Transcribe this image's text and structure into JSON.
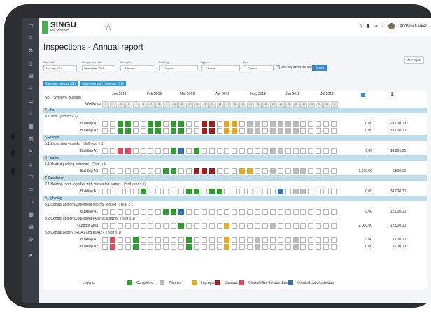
{
  "header": {
    "logo_name": "SINGU",
    "logo_sub": "FM Platform",
    "user_name": "Andrew Farker"
  },
  "page": {
    "title": "Inspections - Annual report",
    "export_label": "XLS export"
  },
  "filters": [
    {
      "label": "Start date",
      "value": "January 2018"
    },
    {
      "label": "Completion date",
      "value": "December 2018"
    },
    {
      "label": "Complex",
      "value": "-- Choose --"
    },
    {
      "label": "Building",
      "value": "-- Choose --"
    },
    {
      "label": "System",
      "value": "-- Choose --"
    },
    {
      "label": "Type",
      "value": "-- Choose --"
    }
  ],
  "filter_checkbox_label": "Just only weeks and daily",
  "search_label": "Search",
  "tags": [
    "Start date: January 2018",
    "Completion date: December 2018"
  ],
  "table": {
    "col_no": "No.",
    "col_system": "System / Building",
    "col_weeks": "Weeks no.",
    "months": [
      "Jan 2018",
      "Feb 2018",
      "Mar 2018",
      "Apr 2018",
      "May 2018",
      "Jun 2018",
      "Jul 2018"
    ],
    "weeks": [
      "1",
      "2",
      "3",
      "4",
      "5",
      "6",
      "7",
      "8",
      "9",
      "10",
      "11",
      "12",
      "13",
      "14",
      "15",
      "16",
      "17",
      "18",
      "19",
      "20",
      "21",
      "22",
      "23",
      "24",
      "25",
      "26",
      "27",
      "28",
      "29",
      "30",
      "31"
    ],
    "sum_label": "Σ"
  },
  "rows": [
    {
      "kind": "section",
      "text": "4 Lifts"
    },
    {
      "kind": "group",
      "no": "4.1",
      "name": "Lifts",
      "freq": "(Month x 1)"
    },
    {
      "kind": "building",
      "name": "Building A1",
      "cells": "..GG..GG.GG..RR.YY.PP.PPPP",
      "v1": "0.00",
      "v2": "28,000.00"
    },
    {
      "kind": "building",
      "name": "Building A2",
      "cells": "..GG..GG.GG..RR.YY.PP.PPPP",
      "v1": "0.00",
      "v2": "28,000.00"
    },
    {
      "kind": "section",
      "text": "5 Fittings"
    },
    {
      "kind": "group",
      "no": "5.1",
      "name": "Expansion vessels",
      "freq": "(Half year x 1)"
    },
    {
      "kind": "building",
      "name": "Building A1",
      "cells": "..LL.....GB.G.........PP.....",
      "v1": "0.00",
      "v2": "14,000.00"
    },
    {
      "kind": "section",
      "text": "6 Heating"
    },
    {
      "kind": "group",
      "no": "6.1",
      "name": "Heated parking entrance",
      "freq": "(Year x 1)"
    },
    {
      "kind": "building",
      "name": "Building A2",
      "cells": "........GG..RRR...YY..P..PP.",
      "v1": "1,500.00",
      "v2": "6,500.00"
    },
    {
      "kind": "section",
      "text": "7 Substation"
    },
    {
      "kind": "group",
      "no": "7.1",
      "name": "Heating room together with circulation pumps",
      "freq": "(Half year x 1)"
    },
    {
      "kind": "building",
      "name": "Building A1",
      "cells": ".....G.....GG.GG.......B.PP..",
      "v1": "0.00",
      "v2": "34,000.00"
    },
    {
      "kind": "section",
      "text": "8 Lightning"
    },
    {
      "kind": "group",
      "no": "8.1",
      "name": "Control and/or supplement internal lighting",
      "freq": "(Year x 1)"
    },
    {
      "kind": "building",
      "name": "Building A1",
      "cells": "........GGB.................",
      "v1": "0.00",
      "v2": "12,000.00"
    },
    {
      "kind": "group",
      "no": "8.2",
      "name": "Control and/or supplement external lighting",
      "freq": "(Year x 1)"
    },
    {
      "kind": "building",
      "name": "Outdoor area",
      "cells": "..........G.....Y.....P.....",
      "v1": "2,000.00",
      "v2": "12,000.00"
    },
    {
      "kind": "group",
      "no": "8.3",
      "name": "Central battery (RDA1 and RDA2)",
      "freq": "(Year x 1)"
    },
    {
      "kind": "building",
      "name": "Building A1",
      "cells": ".L..G......G....Y...P....P...",
      "v1": "0.00",
      "v2": "5,000.00"
    },
    {
      "kind": "building",
      "name": "Building A2",
      "cells": ".L..G......G....Y...P....P...",
      "v1": "0.00",
      "v2": "5,000.00"
    }
  ],
  "legend": {
    "title": "Legend:",
    "items": [
      {
        "label": "Completed",
        "color": "#2ca02c"
      },
      {
        "label": "Planned",
        "color": "#bbbbbb"
      },
      {
        "label": "In progress",
        "color": "#e8a91e"
      },
      {
        "label": "Overdue",
        "color": "#a51d1d"
      },
      {
        "label": "Closed after the due date",
        "color": "#e8445a"
      },
      {
        "label": "Created out of schedule",
        "color": "#2f72b7"
      }
    ]
  }
}
